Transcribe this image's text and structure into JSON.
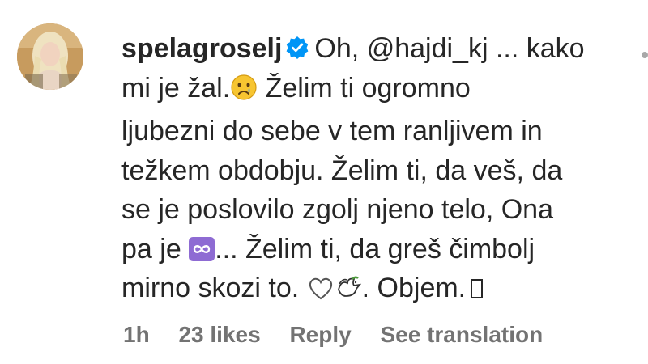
{
  "comment": {
    "username": "spelagroselj",
    "verified": true,
    "mention": "@hajdi_kj",
    "line1_pre": "Oh,",
    "line1_post": "... kako",
    "line2_pre": "mi je žal.",
    "line2_post": "Želim ti ogromno",
    "line3": "ljubezni do sebe v tem ranljivem in",
    "line4": "težkem obdobju. Želim ti, da veš, da",
    "line5": "se je poslovilo zgolj njeno telo, Ona",
    "line6_pre": "pa je",
    "line6_post": "... Želim ti, da greš čimbolj",
    "line7_pre": "mirno skozi to.",
    "line7_post": ". Objem.",
    "emojis": [
      "crying-face-icon",
      "infinity-icon",
      "white-heart-icon",
      "dove-icon",
      "unrendered-glyph"
    ]
  },
  "meta": {
    "time": "1h",
    "likes": "23 likes",
    "reply": "Reply",
    "translate": "See translation"
  },
  "colors": {
    "text": "#262626",
    "meta": "#737373",
    "verified": "#0095f6",
    "infinity_bg": "#8e6bd3"
  }
}
